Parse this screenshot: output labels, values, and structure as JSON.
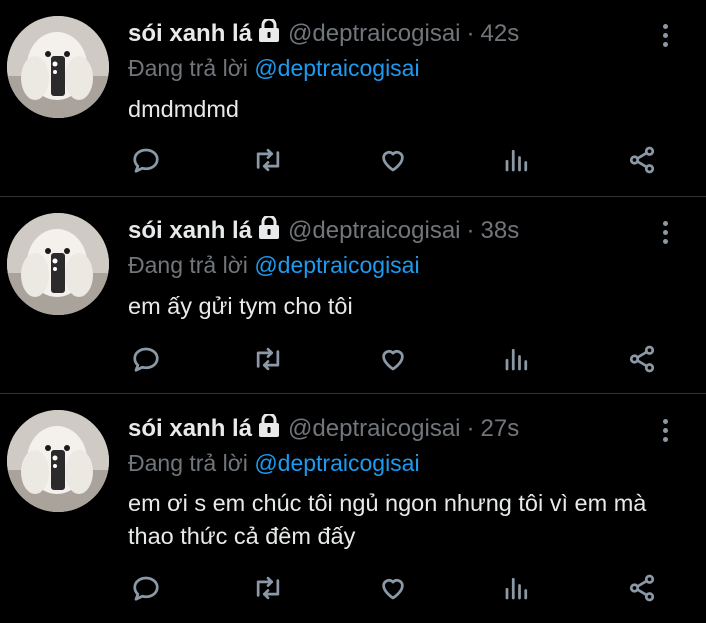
{
  "tweets": [
    {
      "display_name": "sói xanh lá",
      "handle": "@deptraicogisai",
      "separator": "·",
      "time": "42s",
      "reply_prefix": "Đang trả lời",
      "reply_to": "@deptraicogisai",
      "text": "dmdmdmd"
    },
    {
      "display_name": "sói xanh lá",
      "handle": "@deptraicogisai",
      "separator": "·",
      "time": "38s",
      "reply_prefix": "Đang trả lời",
      "reply_to": "@deptraicogisai",
      "text": "em ấy gửi tym cho tôi"
    },
    {
      "display_name": "sói xanh lá",
      "handle": "@deptraicogisai",
      "separator": "·",
      "time": "27s",
      "reply_prefix": "Đang trả lời",
      "reply_to": "@deptraicogisai",
      "text": "em ơi s em chúc tôi ngủ ngon nhưng tôi vì em mà thao thức cả đêm đấy"
    }
  ],
  "icons": {
    "lock": "lock-icon",
    "more": "more-vertical-icon",
    "reply": "reply-icon",
    "retweet": "retweet-icon",
    "like": "heart-icon",
    "analytics": "analytics-icon",
    "share": "share-icon"
  },
  "colors": {
    "background": "#000000",
    "text_primary": "#e7e9ea",
    "text_secondary": "#71767b",
    "accent": "#1d9bf0",
    "icon": "#8b98a5",
    "divider": "#2f3336"
  }
}
